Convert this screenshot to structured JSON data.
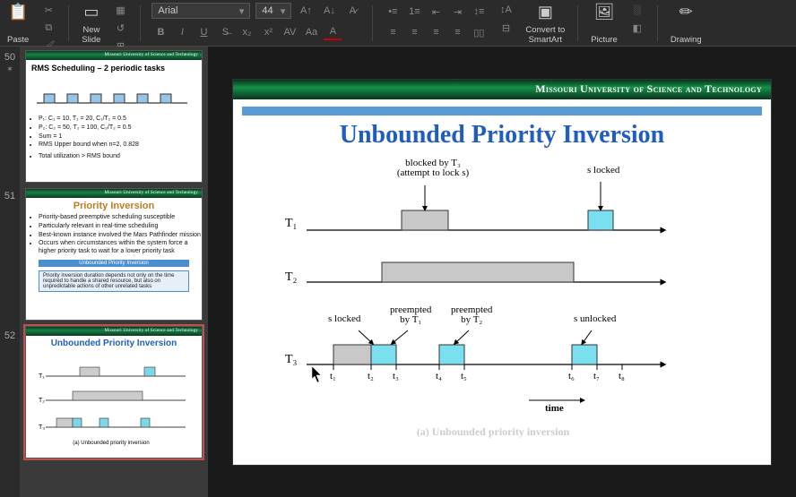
{
  "ribbon": {
    "paste": "Paste",
    "new_slide": "New\nSlide",
    "font_name": "Arial",
    "font_size": "44",
    "convert": "Convert to\nSmartArt",
    "picture": "Picture",
    "drawing": "Drawing"
  },
  "thumbs": {
    "uni": "Missouri University of Science and Technology",
    "n50": "50",
    "n51": "51",
    "n52": "52",
    "t50_title": "RMS Scheduling – 2 periodic tasks",
    "t50_b1": "P₁: C₁ = 10, T₁ = 20, C₁/T₁ = 0.5",
    "t50_b2": "P₂: C₂ = 50, T₂ = 100, C₂/T₂ = 0.5",
    "t50_b3": "Sum = 1",
    "t50_b4": "RMS Upper bound when n=2, 0.828",
    "t50_b5": "Total utilization > RMS bound",
    "t51_title": "Priority Inversion",
    "t51_b1": "Priority-based preemptive scheduling susceptible",
    "t51_b2": "Particularly relevant in real-time scheduling",
    "t51_b3": "Best-known instance involved the Mars Pathfinder mission",
    "t51_b4": "Occurs when circumstances within the system force a higher priority task to wait for a lower priority task",
    "t51_box_title": "Unbounded Priority Inversion",
    "t51_box_body": "Priority inversion duration depends not only on the time required to handle a shared resource, but also on unpredictable actions of other unrelated tasks",
    "t52_title": "Unbounded Priority Inversion"
  },
  "slide": {
    "uni": "Missouri University of Science and Technology",
    "title": "Unbounded Priority Inversion",
    "blocked_label": "blocked by T₃\n(attempt to lock s)",
    "slocked": "s locked",
    "sunlocked": "s unlocked",
    "pre_t1": "preempted\nby T₁",
    "pre_t2": "preempted\nby T₂",
    "T1": "T₁",
    "T2": "T₂",
    "T3": "T₃",
    "t1_": "t₁",
    "t2_": "t₂",
    "t3_": "t₃",
    "t4_": "t₄",
    "t5_": "t₅",
    "t6_": "t₆",
    "t7_": "t₇",
    "t8_": "t₈",
    "time": "time",
    "caption": "(a) Unbounded priority inversion"
  },
  "chart_data": {
    "type": "gantt",
    "title": "Unbounded Priority Inversion",
    "xlabel": "time",
    "xticks": [
      "t1",
      "t2",
      "t3",
      "t4",
      "t5",
      "t6",
      "t7",
      "t8"
    ],
    "tasks": [
      "T1",
      "T2",
      "T3"
    ],
    "series": [
      {
        "task": "T1",
        "segments": [
          {
            "from": "t3",
            "to": "t4",
            "state": "blocked",
            "label": "blocked by T3 (attempt to lock s)",
            "color": "gray"
          },
          {
            "from": "t6",
            "to": "t7",
            "state": "critical-section",
            "label": "s locked",
            "color": "cyan"
          }
        ]
      },
      {
        "task": "T2",
        "segments": [
          {
            "from": "t2",
            "to": "t6",
            "state": "running",
            "color": "gray"
          }
        ]
      },
      {
        "task": "T3",
        "segments": [
          {
            "from": "t1",
            "to": "t2",
            "state": "running",
            "color": "gray"
          },
          {
            "from": "t2",
            "to": "t3",
            "state": "critical-section",
            "label": "s locked",
            "color": "cyan"
          },
          {
            "from": "t4",
            "to": "t5",
            "state": "critical-section",
            "label": "preempted by T1 / preempted by T2",
            "color": "cyan"
          },
          {
            "from": "t6",
            "to": "t7",
            "state": "critical-section",
            "label": "s unlocked",
            "color": "cyan"
          }
        ]
      }
    ]
  }
}
